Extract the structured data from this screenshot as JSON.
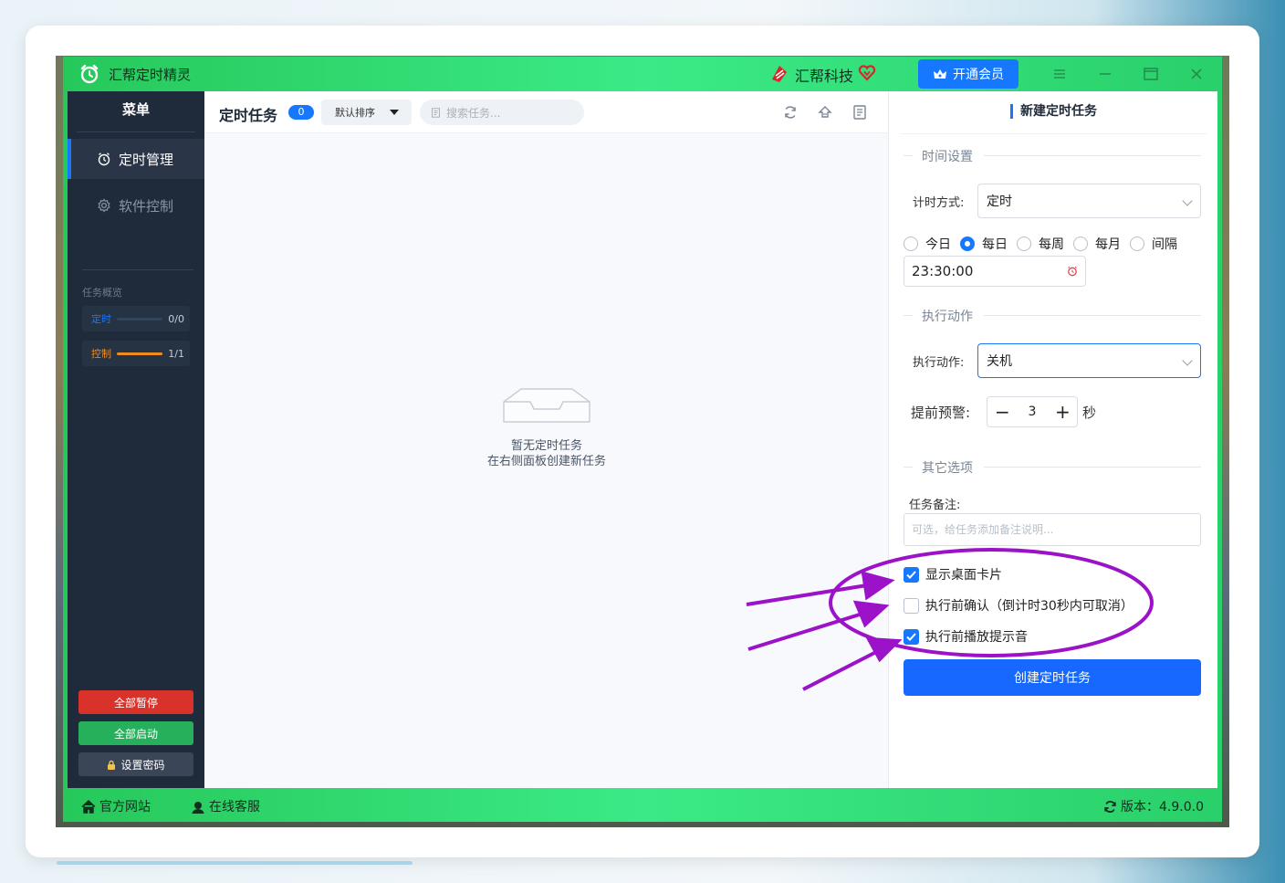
{
  "titlebar": {
    "app_title": "汇帮定时精灵",
    "brand_name": "汇帮科技",
    "vip_label": "开通会员"
  },
  "sidebar": {
    "header": "菜单",
    "items": [
      {
        "label": "定时管理",
        "icon": "alarm-clock-icon",
        "active": true
      },
      {
        "label": "软件控制",
        "icon": "gear-icon",
        "active": false
      }
    ],
    "overview_title": "任务概览",
    "overview": [
      {
        "label": "定时",
        "count": "0/0",
        "progress": 0,
        "color": "#1677ff"
      },
      {
        "label": "控制",
        "count": "1/1",
        "progress": 1,
        "color": "#f08c1e"
      }
    ],
    "buttons": {
      "pause_all": "全部暂停",
      "start_all": "全部启动",
      "set_password": "设置密码"
    }
  },
  "main": {
    "title": "定时任务",
    "count": "0",
    "sort_label": "默认排序",
    "search_placeholder": "搜索任务...",
    "empty_line1": "暂无定时任务",
    "empty_line2": "在右侧面板创建新任务"
  },
  "panel": {
    "title": "新建定时任务",
    "section_time": "时间设置",
    "mode_label": "计时方式:",
    "mode_value": "定时",
    "radios": [
      {
        "label": "今日",
        "checked": false
      },
      {
        "label": "每日",
        "checked": true
      },
      {
        "label": "每周",
        "checked": false
      },
      {
        "label": "每月",
        "checked": false
      },
      {
        "label": "间隔",
        "checked": false
      }
    ],
    "time_value": "23:30:00",
    "section_action": "执行动作",
    "action_label": "执行动作:",
    "action_value": "关机",
    "warn_label": "提前预警:",
    "warn_value": "3",
    "warn_unit": "秒",
    "section_other": "其它选项",
    "note_label": "任务备注:",
    "note_placeholder": "可选，给任务添加备注说明...",
    "checks": [
      {
        "label": "显示桌面卡片",
        "checked": true
      },
      {
        "label": "执行前确认（倒计时30秒内可取消）",
        "checked": false
      },
      {
        "label": "执行前播放提示音",
        "checked": true
      }
    ],
    "create_label": "创建定时任务"
  },
  "footer": {
    "website": "官方网站",
    "support": "在线客服",
    "version": "版本：4.9.0.0"
  },
  "colors": {
    "accent": "#1677ff",
    "titlebar": "#2ad06a",
    "sidebar": "#1f2a3a",
    "annotation": "#9b12c9",
    "danger": "#d8322b",
    "success": "#26b05c"
  }
}
